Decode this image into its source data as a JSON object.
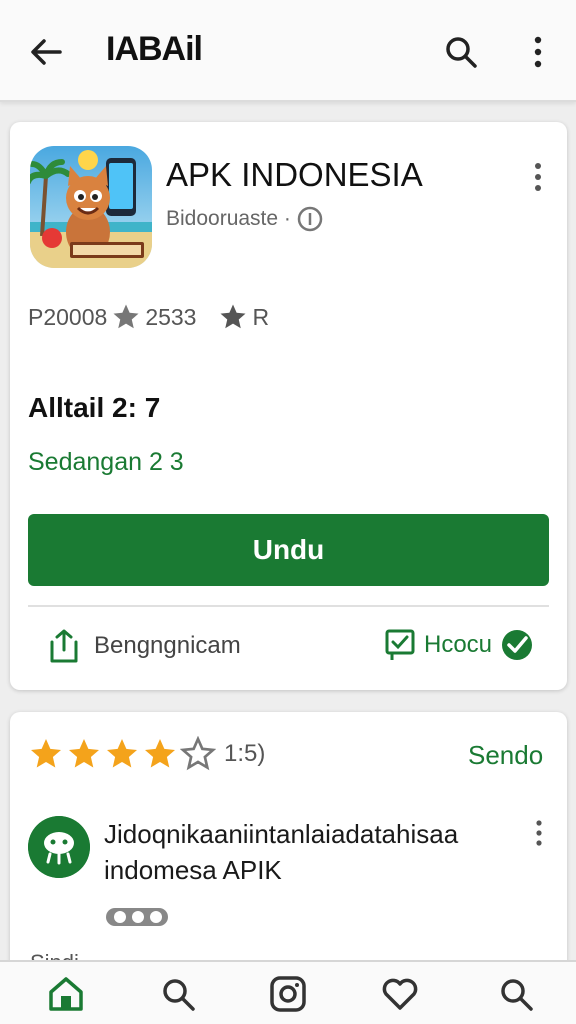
{
  "topbar": {
    "title": "IABAil"
  },
  "app": {
    "name": "APK INDONESIA",
    "developer": "Bidooruaste ·",
    "stat_downloads": "P20008",
    "stat_rating": "2533",
    "stat_extra": "R"
  },
  "details": {
    "title": "Alltail 2: 7",
    "status": "Sedangan 2 3",
    "download_label": "Undu",
    "share_label": "Bengngnicam",
    "report_label": "Hcocu"
  },
  "reviews": {
    "rating_stars": 4,
    "rating_count": "1:5)",
    "see_all": "Sendo",
    "review_text": "Jidoqnikaaniintanlaiadatahisaa indomesa APIK",
    "review_snippet": "Sindi..."
  },
  "colors": {
    "accent": "#1a7a33",
    "star": "#f4a31b"
  },
  "icons": {
    "back": "back-arrow-icon",
    "search": "search-icon",
    "more": "more-vert-icon",
    "verify": "verified-icon",
    "share": "share-icon",
    "report": "flag-icon",
    "home": "home-icon",
    "camera": "camera-icon",
    "heart": "heart-icon"
  }
}
